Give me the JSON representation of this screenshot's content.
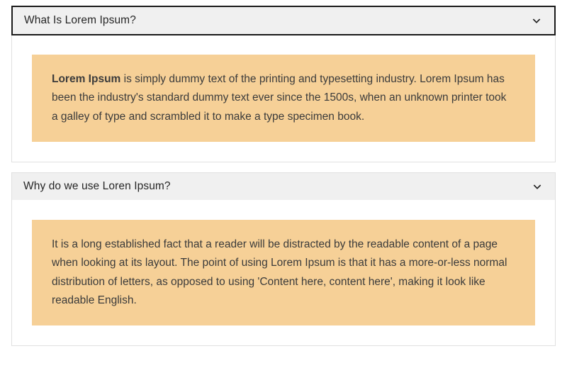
{
  "colors": {
    "header_bg": "#f0f0f0",
    "body_bg": "#f6d097",
    "header_border_active": "#1a1a1a"
  },
  "accordion": [
    {
      "title": "What Is Lorem Ipsum?",
      "expanded": true,
      "active": true,
      "body_lead_bold": "Lorem Ipsum",
      "body_rest": " is simply dummy text of the printing and typesetting industry. Lorem Ipsum has been the industry's standard dummy text ever since the 1500s, when an unknown printer took a galley of type and scrambled it to make a type specimen book."
    },
    {
      "title": "Why do we use Loren Ipsum?",
      "expanded": true,
      "active": false,
      "body_lead_bold": "",
      "body_rest": "It is a long established fact that a reader will be distracted by the readable content of a page when looking at its layout. The point of using Lorem Ipsum is that it has a more-or-less normal distribution of letters, as opposed to using 'Content here, content here', making it look like readable English."
    }
  ]
}
